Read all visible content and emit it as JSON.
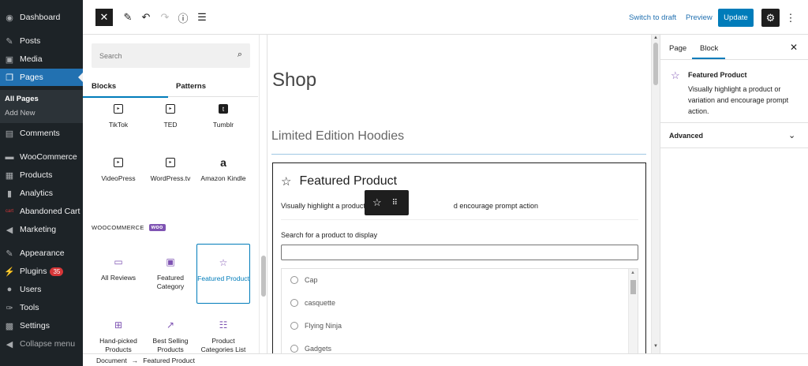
{
  "admin_menu": {
    "items": [
      {
        "label": "Dashboard",
        "icon": "dashboard-icon",
        "glyph": "◉"
      },
      {
        "label": "Posts",
        "icon": "pin-icon",
        "glyph": "✎"
      },
      {
        "label": "Media",
        "icon": "media-icon",
        "glyph": "▣"
      },
      {
        "label": "Pages",
        "icon": "pages-icon",
        "glyph": "❐"
      },
      {
        "label": "Comments",
        "icon": "comments-icon",
        "glyph": "▤"
      },
      {
        "label": "WooCommerce",
        "icon": "woocommerce-icon",
        "glyph": "▬"
      },
      {
        "label": "Products",
        "icon": "products-icon",
        "glyph": "▦"
      },
      {
        "label": "Analytics",
        "icon": "analytics-icon",
        "glyph": "▮"
      },
      {
        "label": "Abandoned Cart",
        "icon": "abandoned-cart-icon",
        "glyph": "cart"
      },
      {
        "label": "Marketing",
        "icon": "marketing-icon",
        "glyph": "◀"
      },
      {
        "label": "Appearance",
        "icon": "appearance-icon",
        "glyph": "✎"
      },
      {
        "label": "Plugins",
        "icon": "plugins-icon",
        "glyph": "⚡"
      },
      {
        "label": "Users",
        "icon": "users-icon",
        "glyph": "●"
      },
      {
        "label": "Tools",
        "icon": "tools-icon",
        "glyph": "✑"
      },
      {
        "label": "Settings",
        "icon": "settings-icon",
        "glyph": "▩"
      },
      {
        "label": "Collapse menu",
        "icon": "collapse-icon",
        "glyph": "◀"
      }
    ],
    "submenu": [
      "All Pages",
      "Add New"
    ],
    "plugins_badge": "35"
  },
  "toolbar": {
    "close_glyph": "✕",
    "tools_glyph": "✎",
    "undo_glyph": "↶",
    "redo_glyph": "↷",
    "info_glyph": "ⓘ",
    "outline_glyph": "☰",
    "switch_to_draft": "Switch to draft",
    "preview": "Preview",
    "update": "Update",
    "settings_glyph": "⚙",
    "more_glyph": "⋮"
  },
  "inserter": {
    "search_placeholder": "Search",
    "search_glyph": "⌕",
    "tabs": [
      "Blocks",
      "Patterns"
    ],
    "embed_blocks": [
      {
        "label": "TikTok",
        "glyph": "▸"
      },
      {
        "label": "TED",
        "glyph": "▸"
      },
      {
        "label": "Tumblr",
        "glyph": "t"
      },
      {
        "label": "VideoPress",
        "glyph": "▸"
      },
      {
        "label": "WordPress.tv",
        "glyph": "▸"
      },
      {
        "label": "Amazon Kindle",
        "glyph": "a"
      }
    ],
    "woo_heading": "WOOCOMMERCE",
    "woo_logo": "woo",
    "woo_blocks": [
      {
        "label": "All Reviews",
        "glyph": "▭"
      },
      {
        "label": "Featured Category",
        "glyph": "▣"
      },
      {
        "label": "Featured Product",
        "glyph": "☆"
      },
      {
        "label": "Hand-picked Products",
        "glyph": "⊞"
      },
      {
        "label": "Best Selling Products",
        "glyph": "↗"
      },
      {
        "label": "Product Categories List",
        "glyph": "☷"
      }
    ]
  },
  "canvas": {
    "page_title": "Shop",
    "subheading": "Limited Edition Hoodies",
    "featured_block": {
      "title": "Featured Product",
      "star_glyph": "☆",
      "desc_left": "Visually highlight a product",
      "desc_right": "d encourage prompt action",
      "search_label": "Search for a product to display",
      "search_value": "",
      "products": [
        "Cap",
        "casquette",
        "Flying Ninja",
        "Gadgets"
      ]
    },
    "floating_toolbar": {
      "star_glyph": "☆",
      "drag_glyph": "⠿"
    }
  },
  "settings_panel": {
    "tabs": [
      "Page",
      "Block"
    ],
    "active_tab": "Block",
    "close_glyph": "✕",
    "block_title": "Featured Product",
    "block_desc": "Visually highlight a product or variation and encourage prompt action.",
    "card_star": "☆",
    "advanced": "Advanced",
    "chevron": "⌄"
  },
  "breadcrumb": {
    "root": "Document",
    "arrow": "→",
    "current": "Featured Product"
  },
  "colors": {
    "accent": "#007cba",
    "admin_bg": "#1d2327",
    "woo_purple": "#7f54b3",
    "badge_red": "#d63638"
  }
}
